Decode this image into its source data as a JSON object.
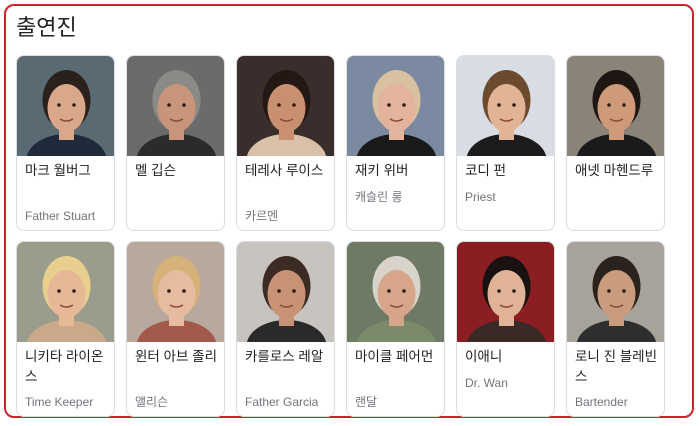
{
  "section_title": "출연진",
  "cast": [
    {
      "name": "마크 월버그",
      "role": "Father Stuart",
      "bg": "#5a6a72",
      "skin": "#d9a88a",
      "hair": "#2a211c",
      "shirt": "#1f2a3a"
    },
    {
      "name": "멜 깁슨",
      "role": "",
      "bg": "#6b6b6b",
      "skin": "#c8957a",
      "hair": "#8a8a86",
      "shirt": "#2b2b2b"
    },
    {
      "name": "테레사 루이스",
      "role": "카르멘",
      "bg": "#3a2e2c",
      "skin": "#c9906f",
      "hair": "#241814",
      "shirt": "#d9c0a8"
    },
    {
      "name": "재키 위버",
      "role": "캐슬린 롱",
      "bg": "#7b8aa0",
      "skin": "#e4b39c",
      "hair": "#d7c1a0",
      "shirt": "#1a1a1a"
    },
    {
      "name": "코디 펀",
      "role": "Priest",
      "bg": "#d8dde3",
      "skin": "#e2b394",
      "hair": "#6b4a2e",
      "shirt": "#1c1c1c"
    },
    {
      "name": "애넷 마헨드루",
      "role": "",
      "bg": "#8a8378",
      "skin": "#cf9a78",
      "hair": "#1e1612",
      "shirt": "#1a1a1a"
    },
    {
      "name": "니키타 라이온스",
      "role": "Time Keeper",
      "bg": "#9a9c8c",
      "skin": "#e7b896",
      "hair": "#e8cf8d",
      "shirt": "#caa88a"
    },
    {
      "name": "윈터 아브 졸리",
      "role": "앨리슨",
      "bg": "#b8a89e",
      "skin": "#e6bba0",
      "hair": "#d6b27a",
      "shirt": "#a35a4a"
    },
    {
      "name": "카를로스 레알",
      "role": "Father Garcia",
      "bg": "#c7c3bf",
      "skin": "#c89274",
      "hair": "#3a2c24",
      "shirt": "#2a2a2a"
    },
    {
      "name": "마이클 페어먼",
      "role": "랜달",
      "bg": "#6e7a64",
      "skin": "#d6a58a",
      "hair": "#d8d4cc",
      "shirt": "#7a8a6a"
    },
    {
      "name": "이애니",
      "role": "Dr. Wan",
      "bg": "#8a1e22",
      "skin": "#e0b396",
      "hair": "#1a1210",
      "shirt": "#3a2a26"
    },
    {
      "name": "로니 진 블레빈스",
      "role": "Bartender",
      "bg": "#a8a39a",
      "skin": "#c99c7e",
      "hair": "#2a221c",
      "shirt": "#2e2e2e"
    }
  ]
}
